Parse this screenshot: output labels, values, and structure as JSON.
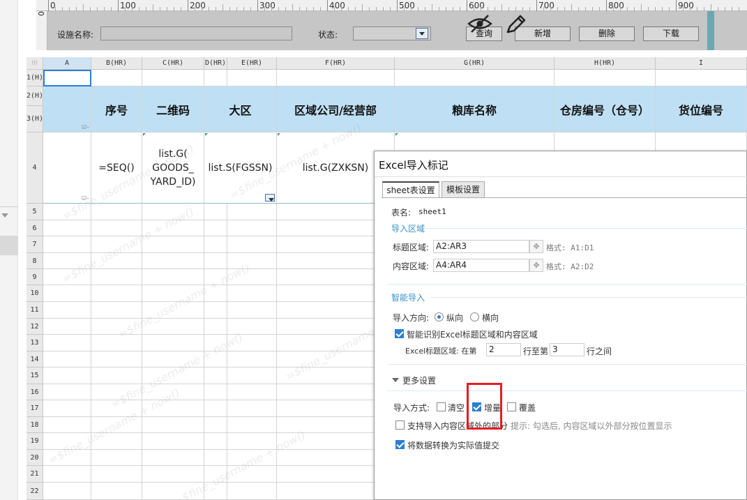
{
  "ruler": {
    "labels": [
      "0",
      "100",
      "200",
      "300",
      "400",
      "500",
      "600",
      "700",
      "800",
      "900"
    ],
    "vertical_label": "0"
  },
  "params": {
    "device_name_label": "设施名称:",
    "status_label": "状态:",
    "query_button": "查询",
    "add_button": "新增",
    "delete_button": "删除",
    "download_button": "下载"
  },
  "grid": {
    "corner": "⁝⁝⁝",
    "columns": [
      "A",
      "B(HR)",
      "C(HR)",
      "D(HR)",
      "E(HR)",
      "F(HR)",
      "G(HR)",
      "H(HR)",
      "I"
    ],
    "rows": [
      "1(H)",
      "2(H)",
      "3(H)",
      "4",
      "5",
      "6",
      "7",
      "8",
      "9",
      "10",
      "11",
      "12",
      "13",
      "14",
      "15",
      "16",
      "17",
      "18",
      "19",
      "20",
      "21",
      "22"
    ],
    "headers": {
      "seq": "序号",
      "qrcode": "二维码",
      "region": "大区",
      "company": "区域公司/经营部",
      "depot": "粮库名称",
      "warehouse": "仓房编号（仓号）",
      "cargo": "货位编号"
    },
    "formulas": {
      "seq": "=SEQ()",
      "qrcode": "list.G( GOODS_ YARD_ID)",
      "region": "list.S(FGSSN)",
      "company": "list.G(ZXKSN)"
    }
  },
  "watermark_text": "=$fine_username + now()",
  "dialog": {
    "title": "Excel导入标记",
    "tabs": [
      "sheet表设置",
      "模板设置"
    ],
    "sheet_name_label": "表名:",
    "sheet_name": "sheet1",
    "import_area_title": "导入区域",
    "title_area_label": "标题区域:",
    "title_area_value": "A2:AR3",
    "title_area_hint": "格式: A1:D1",
    "content_area_label": "内容区域:",
    "content_area_value": "A4:AR4",
    "content_area_hint": "格式: A2:D2",
    "smart_import_title": "智能导入",
    "direction_label": "导入方向:",
    "direction_vertical": "纵向",
    "direction_horizontal": "横向",
    "smart_detect_label": "智能识别Excel标题区域和内容区域",
    "excel_title_area_label": "Excel标题区域: 在第",
    "row_from": "2",
    "row_to_label": "行至第",
    "row_to": "3",
    "row_between_label": "行之间",
    "more_settings_title": "更多设置",
    "import_mode_label": "导入方式:",
    "mode_clear": "清空",
    "mode_increment": "增量",
    "mode_overwrite": "覆盖",
    "support_outside_label": "支持导入内容区域外的部分",
    "support_outside_hint": "提示: 勾选后, 内容区域以外部分按位置显示",
    "convert_actual_label": "将数据转换为实际值提交"
  },
  "colors": {
    "header_fill": "#bfe0f4",
    "accent": "#2d7dd2",
    "highlight": "#e51c23",
    "section_title": "#3b8fc9"
  }
}
